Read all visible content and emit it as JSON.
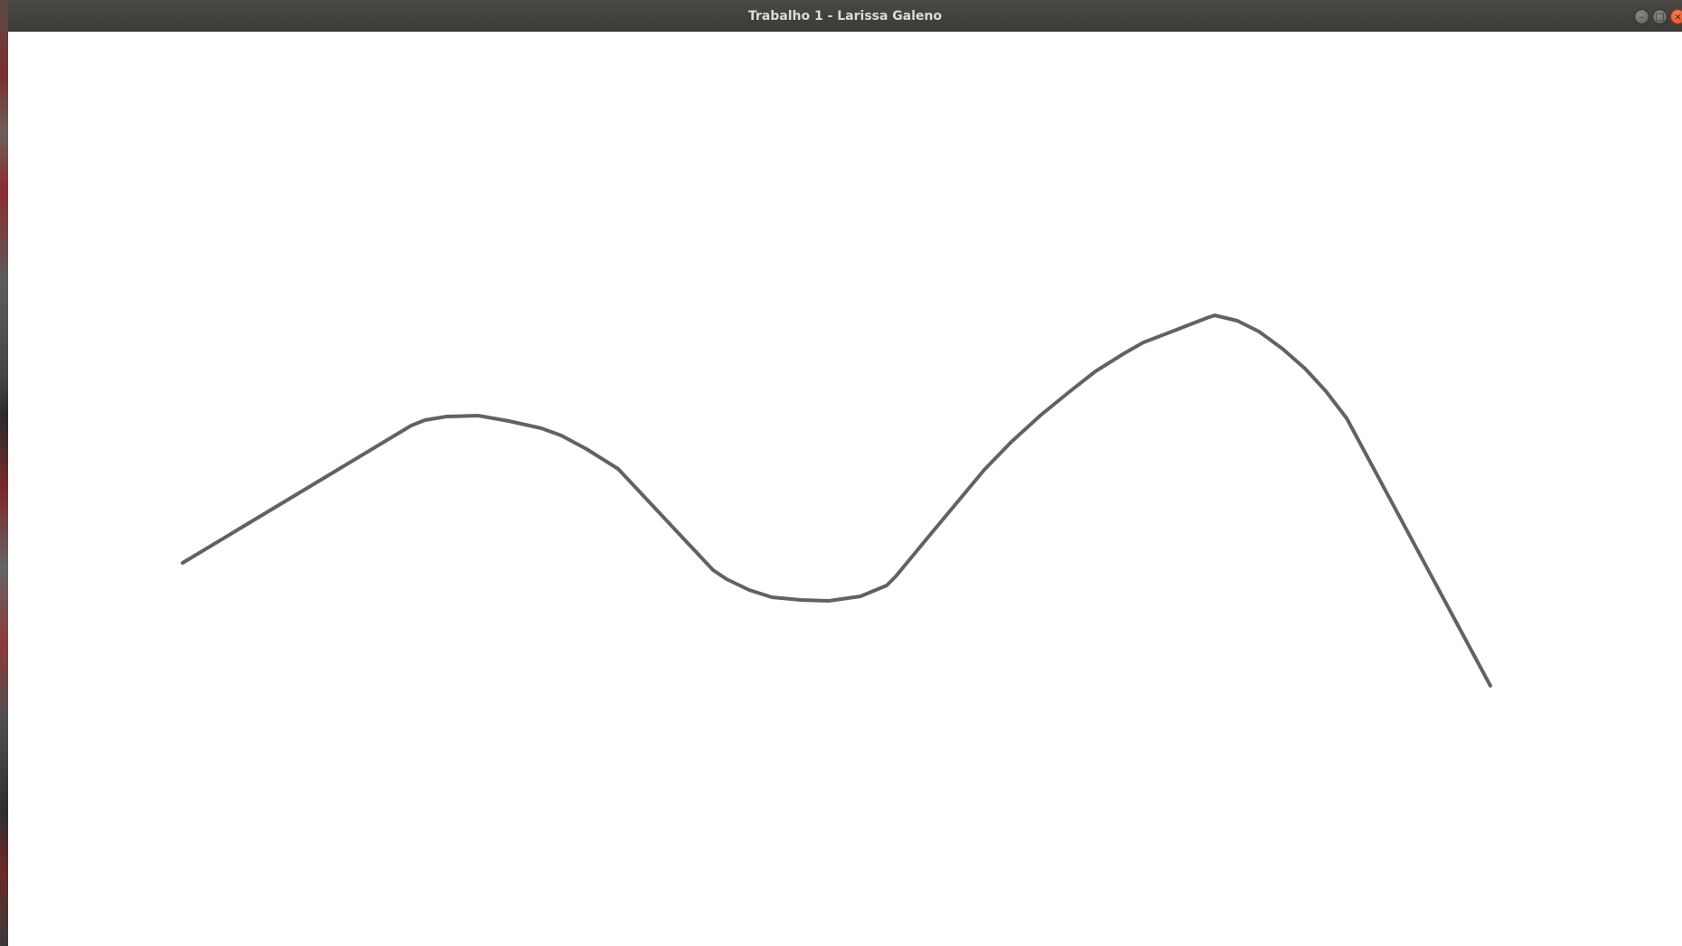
{
  "window": {
    "title": "Trabalho 1 - Larissa Galeno"
  },
  "controls": {
    "minimize_icon": "minimize-icon",
    "maximize_icon": "maximize-icon",
    "close_icon": "close-icon"
  },
  "colors": {
    "titlebar": "#3c3b37",
    "title_text": "#dfdbd2",
    "curve": "#626262",
    "canvas": "#ffffff",
    "close_button": "#e95420"
  }
}
